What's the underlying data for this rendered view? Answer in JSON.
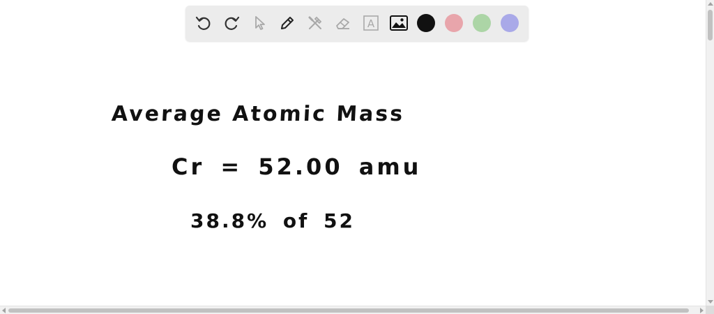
{
  "toolbar": {
    "tools": [
      {
        "name": "undo-icon"
      },
      {
        "name": "redo-icon"
      },
      {
        "name": "select-pointer-icon"
      },
      {
        "name": "pen-icon"
      },
      {
        "name": "tools-icon"
      },
      {
        "name": "eraser-icon"
      },
      {
        "name": "text-box-icon",
        "glyph": "A"
      },
      {
        "name": "image-icon"
      }
    ],
    "colors": [
      "#111111",
      "#e8a5ab",
      "#acd5a6",
      "#a9a9e8"
    ]
  },
  "canvas": {
    "handwriting": {
      "title": "Average Atomic Mass",
      "line1": "Cr = 52.00 amu",
      "line2": "38.8% of 52"
    }
  }
}
